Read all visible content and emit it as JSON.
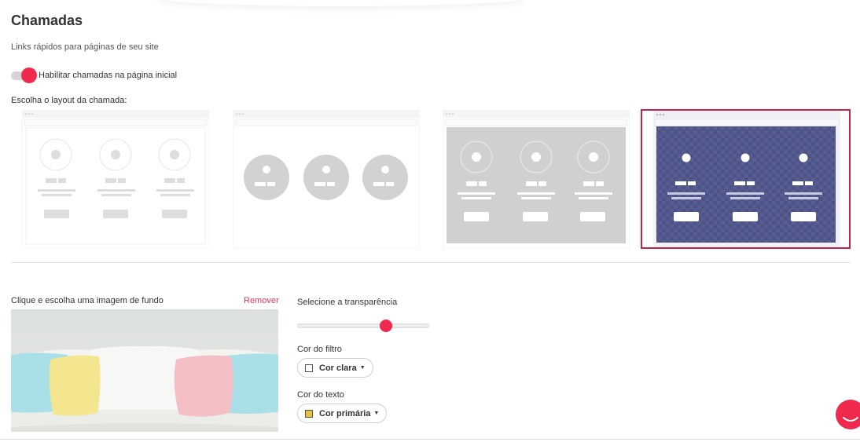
{
  "header": {
    "title": "Chamadas",
    "subtitle": "Links rápidos para páginas de seu site"
  },
  "toggle": {
    "label": "Habilitar chamadas na página inicial",
    "enabled": true
  },
  "layout": {
    "label": "Escolha o layout da chamada:",
    "options": [
      {
        "name": "layout-outline-circles",
        "selected": false
      },
      {
        "name": "layout-filled-circles",
        "selected": false
      },
      {
        "name": "layout-gray-background",
        "selected": false
      },
      {
        "name": "layout-image-background",
        "selected": true
      }
    ]
  },
  "background": {
    "label": "Clique e escolha uma imagem de fundo",
    "remove_label": "Remover"
  },
  "transparency": {
    "label": "Selecione a transparência",
    "value": 0.69
  },
  "filter_color": {
    "label": "Cor do filtro",
    "button_label": "Cor clara",
    "swatch_color": "#ffffff"
  },
  "text_color": {
    "label": "Cor do texto",
    "button_label": "Cor primária",
    "swatch_color": "#e8c13a"
  },
  "colors": {
    "accent": "#f0294f",
    "selected_border": "#c0224a",
    "remove_link": "#e8335a",
    "layout_overlay": "#4d5387"
  }
}
